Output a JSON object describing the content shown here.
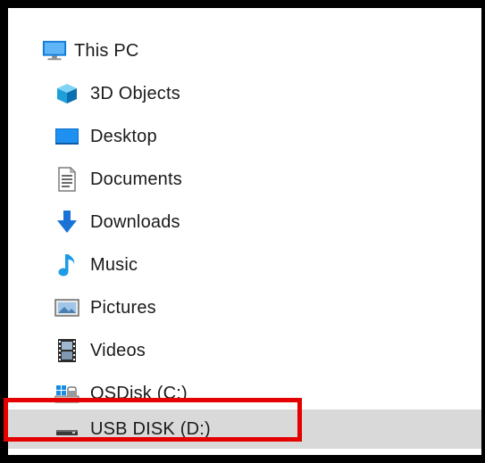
{
  "nav_tree": {
    "root": {
      "label": "This PC",
      "icon": "this-pc-icon"
    },
    "items": [
      {
        "label": "3D Objects",
        "icon": "3d-objects-icon"
      },
      {
        "label": "Desktop",
        "icon": "desktop-icon"
      },
      {
        "label": "Documents",
        "icon": "documents-icon"
      },
      {
        "label": "Downloads",
        "icon": "downloads-icon"
      },
      {
        "label": "Music",
        "icon": "music-icon"
      },
      {
        "label": "Pictures",
        "icon": "pictures-icon"
      },
      {
        "label": "Videos",
        "icon": "videos-icon"
      },
      {
        "label": "OSDisk (C:)",
        "icon": "os-disk-icon"
      },
      {
        "label": "USB DISK (D:)",
        "icon": "usb-drive-icon",
        "selected": true
      }
    ]
  },
  "annotation": {
    "highlight_color": "#e50000",
    "highlighted_item": "USB DISK (D:)"
  }
}
